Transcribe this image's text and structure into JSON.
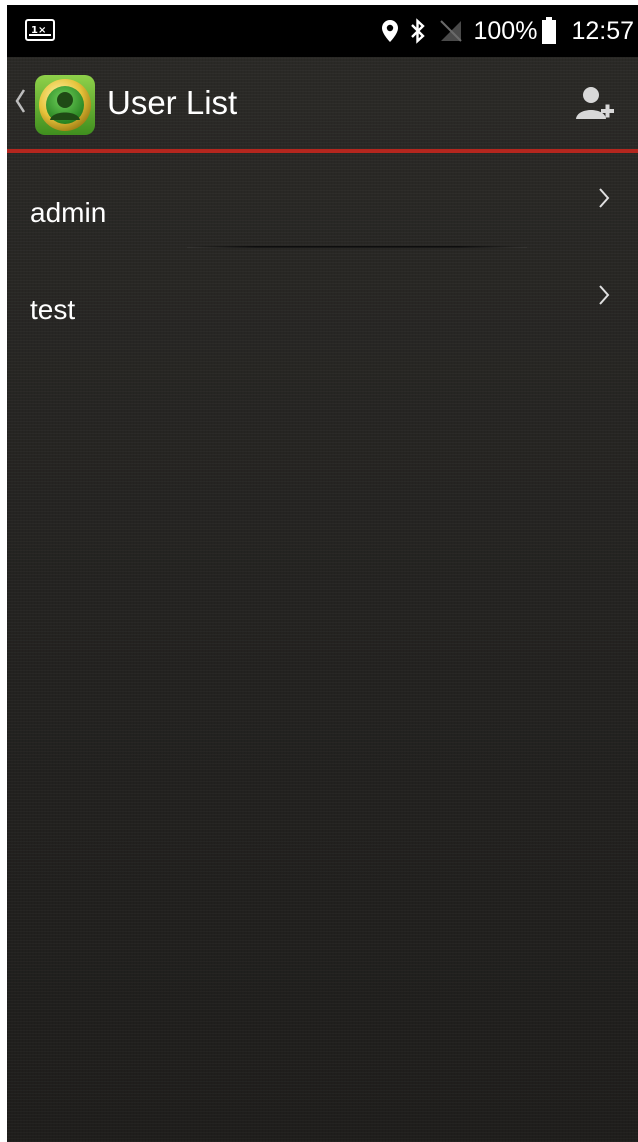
{
  "status_bar": {
    "left_icon": "sim-card-error-icon",
    "icons": [
      "location-icon",
      "bluetooth-icon",
      "no-signal-icon"
    ],
    "battery_percent": "100%",
    "battery_icon": "battery-full-icon",
    "time": "12:57"
  },
  "header": {
    "back_icon": "chevron-left-icon",
    "app_icon": "user-app-icon",
    "title": "User List",
    "add_user_icon": "add-user-icon"
  },
  "users": [
    {
      "name": "admin",
      "chevron_icon": "chevron-right-icon"
    },
    {
      "name": "test",
      "chevron_icon": "chevron-right-icon"
    }
  ],
  "colors": {
    "accent_divider": "#b4261e",
    "background": "#262523",
    "status_bar": "#000000",
    "text": "#ffffff"
  }
}
